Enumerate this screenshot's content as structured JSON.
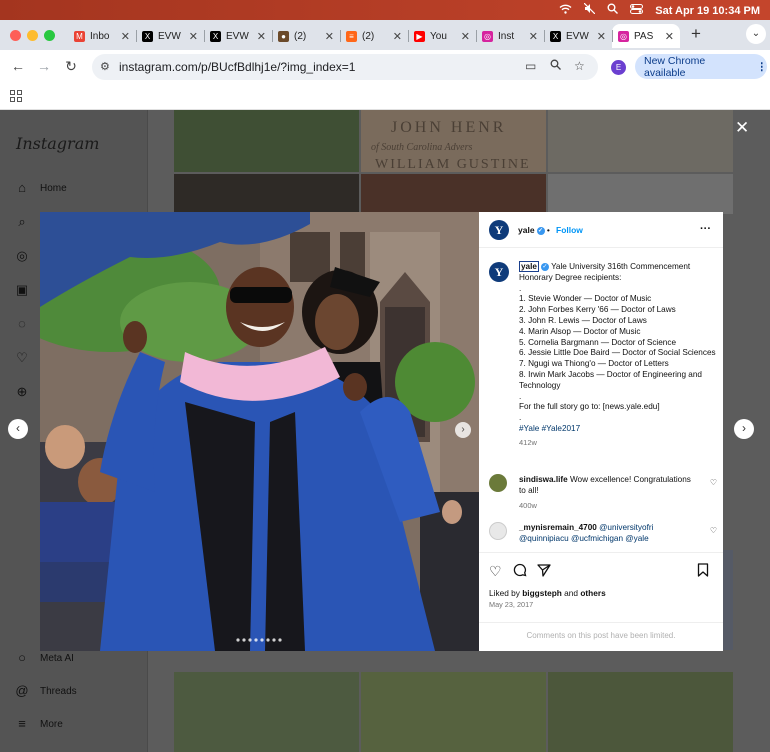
{
  "menubar": {
    "date_time": "Sat Apr 19  10:34 PM"
  },
  "tabs": [
    {
      "label": "Inbo",
      "icon": "gmail-icon",
      "color": "#ea4335",
      "glyph": "M"
    },
    {
      "label": "EVW",
      "icon": "x-icon",
      "color": "#000000",
      "glyph": "X"
    },
    {
      "label": "EVW",
      "icon": "x-icon",
      "color": "#000000",
      "glyph": "X"
    },
    {
      "label": "(2)",
      "icon": "site-icon",
      "color": "#6b4a2a",
      "glyph": "●"
    },
    {
      "label": "(2)",
      "icon": "substack-icon",
      "color": "#ff6719",
      "glyph": "≡"
    },
    {
      "label": "You",
      "icon": "youtube-icon",
      "color": "#ff0000",
      "glyph": "▶"
    },
    {
      "label": "Inst",
      "icon": "instagram-icon",
      "color": "#d6249f",
      "glyph": "◎"
    },
    {
      "label": "EVW",
      "icon": "x-icon",
      "color": "#000000",
      "glyph": "X"
    },
    {
      "label": "PAS",
      "icon": "instagram-icon",
      "color": "#d6249f",
      "glyph": "◎",
      "active": true
    }
  ],
  "toolbar": {
    "url": "instagram.com/p/BUcfBdlhj1e/?img_index=1",
    "profile_initial": "E",
    "update_button": "New Chrome available"
  },
  "instagram": {
    "logo": "Instagram",
    "nav": [
      {
        "label": "Home",
        "icon": "home-icon"
      },
      {
        "label": "",
        "icon": "search-icon"
      },
      {
        "label": "",
        "icon": "explore-icon"
      },
      {
        "label": "",
        "icon": "reels-icon"
      },
      {
        "label": "",
        "icon": "messages-icon"
      },
      {
        "label": "",
        "icon": "notifications-icon"
      },
      {
        "label": "",
        "icon": "create-icon"
      },
      {
        "label": "Meta AI",
        "icon": "meta-ai-icon"
      },
      {
        "label": "Threads",
        "icon": "threads-icon"
      },
      {
        "label": "More",
        "icon": "menu-icon"
      }
    ]
  },
  "post": {
    "account": "yale",
    "follow_label": "Follow",
    "separator": "•",
    "avatar_letter": "Y",
    "caption_head": "Yale University 316th Commencement Honorary Degree recipients:",
    "caption_lines": [
      ".",
      "1. Stevie Wonder — Doctor of Music",
      "2. John Forbes Kerry '66 — Doctor of Laws",
      "3. John R. Lewis — Doctor of Laws",
      "4. Marin Alsop — Doctor of Music",
      "5. Cornelia Bargmann — Doctor of Science",
      "6. Jessie Little Doe Baird — Doctor of Social Sciences",
      "7. Ngugi wa Thiong'o — Doctor of Letters",
      "8. Irwin Mark Jacobs — Doctor of Engineering and Technology",
      ".",
      "For the full story go to: [news.yale.edu]",
      "."
    ],
    "hashtags": "#Yale #Yale2017",
    "caption_age": "412w",
    "comments": [
      {
        "user": "sindiswa.life",
        "text": "Wow excellence! Congratulations to all!",
        "age": "400w",
        "avatar_color": "#6b7a3a"
      },
      {
        "user": "_mynisremain_4700",
        "text_prefix": "",
        "mentions": "@universityofri @quinnipiacu @ucfmichigan @yale",
        "age": "",
        "avatar_color": "#d9d9d9"
      }
    ],
    "liked_by_prefix": "Liked by",
    "liked_by_user": "biggsteph",
    "liked_by_conj": "and",
    "liked_by_others": "others",
    "date": "May 23, 2017",
    "comments_limited": "Comments on this post have been limited."
  },
  "colors": {
    "follow_blue": "#0095f6",
    "verified_blue": "#3897f0",
    "robe_blue": "#2a55b5",
    "hood_pink": "#f2b8d6"
  }
}
